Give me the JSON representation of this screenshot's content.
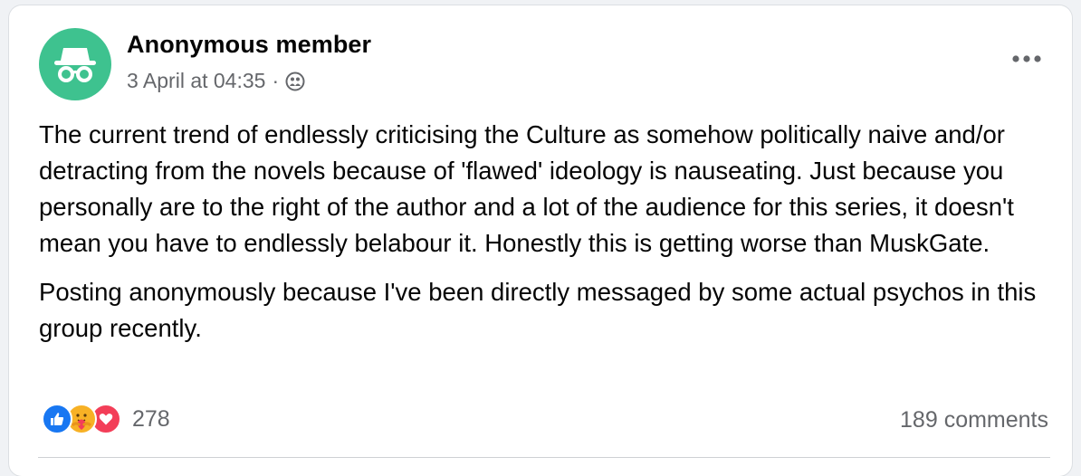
{
  "post": {
    "author": "Anonymous member",
    "timestamp": "3 April at 04:35",
    "separator": "·",
    "privacy_icon": "group-privacy-icon",
    "avatar_icon": "incognito-icon",
    "avatar_color": "#3ec28f",
    "paragraphs": [
      "The current trend of endlessly criticising the Culture as somehow politically naive and/or detracting from the novels because of 'flawed' ideology is nauseating. Just because you personally are to the right of the author and a lot of the audience for this series, it doesn't mean you have to endlessly belabour it. Honestly this is getting worse than MuskGate.",
      "Posting anonymously because I've been directly messaged by some actual psychos in this group recently."
    ]
  },
  "reactions": {
    "icons": [
      "like-icon",
      "care-icon",
      "love-icon"
    ],
    "count": "278"
  },
  "comments": {
    "label": "189 comments"
  }
}
